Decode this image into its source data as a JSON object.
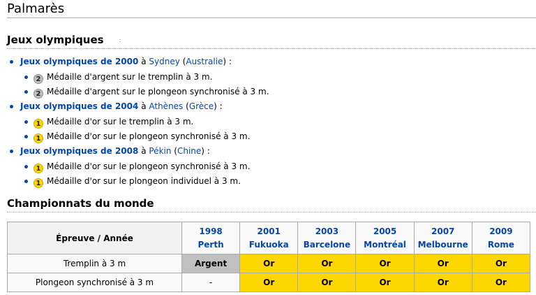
{
  "heading": "Palmarès",
  "olympics": {
    "title": "Jeux olympiques",
    "anchor_mark": ":",
    "entries": [
      {
        "games": "Jeux olympiques de 2000",
        "prep": "à",
        "city": "Sydney",
        "country": "Australie",
        "medals": [
          {
            "badge": "2",
            "type": "silver",
            "text": "Médaille d'argent sur le tremplin à 3 m."
          },
          {
            "badge": "2",
            "type": "silver",
            "text": "Médaille d'argent sur le plongeon synchronisé à 3 m."
          }
        ]
      },
      {
        "games": "Jeux olympiques de 2004",
        "prep": "à",
        "city": "Athènes",
        "country": "Grèce",
        "medals": [
          {
            "badge": "1",
            "type": "gold",
            "text": "Médaille d'or sur le tremplin à 3 m."
          },
          {
            "badge": "1",
            "type": "gold",
            "text": "Médaille d'or sur le plongeon synchronisé à 3 m."
          }
        ]
      },
      {
        "games": "Jeux olympiques de 2008",
        "prep": "à",
        "city": "Pékin",
        "country": "Chine",
        "medals": [
          {
            "badge": "1",
            "type": "gold",
            "text": "Médaille d'or sur le plongeon synchronisé à 3 m."
          },
          {
            "badge": "1",
            "type": "gold",
            "text": "Médaille d'or sur le plongeon individuel à 3 m."
          }
        ]
      }
    ]
  },
  "worlds": {
    "title": "Championnats du monde",
    "header_label": "Épreuve / Année",
    "years": [
      {
        "year": "1998",
        "city": "Perth"
      },
      {
        "year": "2001",
        "city": "Fukuoka"
      },
      {
        "year": "2003",
        "city": "Barcelone"
      },
      {
        "year": "2005",
        "city": "Montréal"
      },
      {
        "year": "2007",
        "city": "Melbourne"
      },
      {
        "year": "2009",
        "city": "Rome"
      }
    ],
    "rows": [
      {
        "event": "Tremplin à 3 m",
        "results": [
          "Argent",
          "Or",
          "Or",
          "Or",
          "Or",
          "Or"
        ]
      },
      {
        "event": "Plongeon synchronisé à 3 m",
        "results": [
          "-",
          "Or",
          "Or",
          "Or",
          "Or",
          "Or"
        ]
      }
    ]
  },
  "colors": {
    "gold": "#ffd700",
    "silver": "#c0c0c0",
    "link": "#0645ad"
  }
}
